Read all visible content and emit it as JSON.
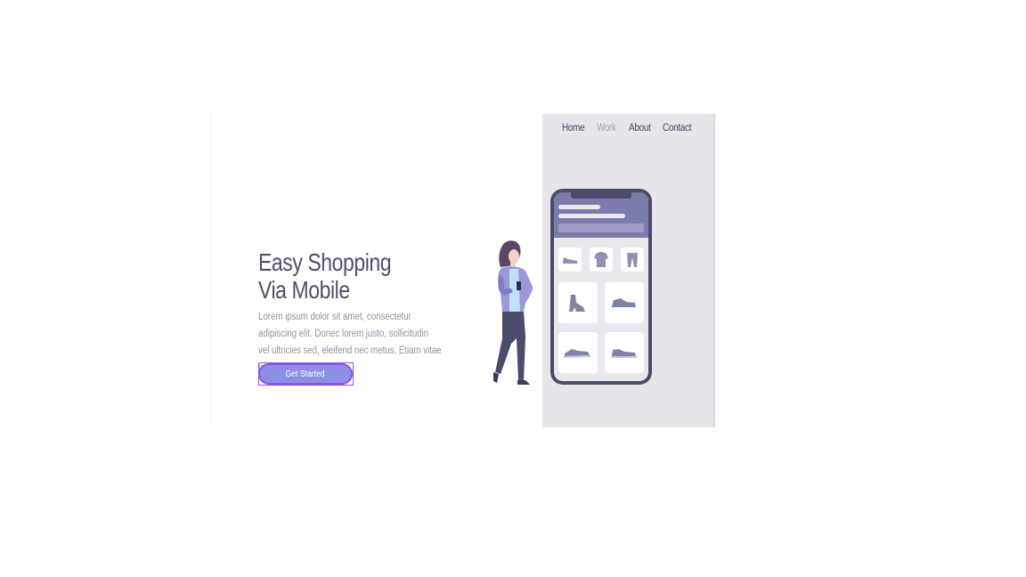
{
  "nav": {
    "items": [
      {
        "label": "Home",
        "active": false
      },
      {
        "label": "Work",
        "active": true
      },
      {
        "label": "About",
        "active": false
      },
      {
        "label": "Contact",
        "active": false
      }
    ]
  },
  "hero": {
    "title_line1": "Easy Shopping",
    "title_line2": "Via Mobile",
    "body": "Lorem ipsum dolor sit amet, consectetur  adipiscing elit. Donec lorem justo, sollicitudin vel ultricies sed, eleifend nec metus. Etiam vitae pellentesque dolor.",
    "cta_label": "Get Started"
  },
  "colors": {
    "heading": "#4e4f6b",
    "body": "#8f8fa3",
    "accent": "#8f8ee6",
    "accent_border": "#8d54e6",
    "panel": "#e6e6ea",
    "phone": "#4b4c6b"
  },
  "illustration": {
    "phone_products": [
      "shoe-icon",
      "tshirt-icon",
      "pants-icon",
      "boot-icon",
      "sneaker-icon",
      "sneaker-icon",
      "sneaker-icon"
    ],
    "person": "woman-with-phone"
  }
}
